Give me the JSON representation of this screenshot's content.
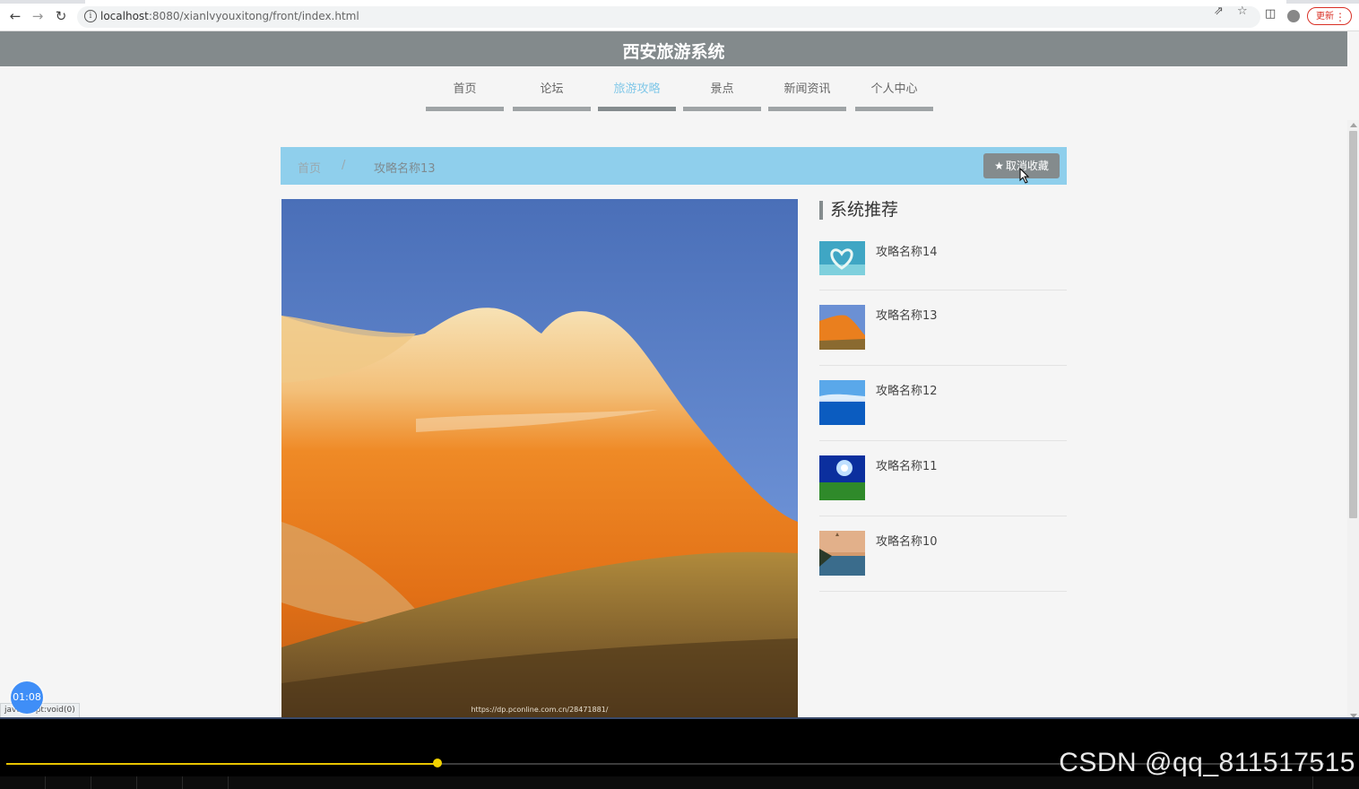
{
  "browser": {
    "url_host": "localhost",
    "url_path": ":8080/xianlvyouxitong/front/index.html",
    "update_label": "更新"
  },
  "site": {
    "title": "西安旅游系统"
  },
  "nav": [
    {
      "label": "首页"
    },
    {
      "label": "论坛"
    },
    {
      "label": "旅游攻略",
      "active": true
    },
    {
      "label": "景点"
    },
    {
      "label": "新闻资讯"
    },
    {
      "label": "个人中心"
    }
  ],
  "breadcrumb": {
    "home": "首页",
    "separator": "/",
    "current": "攻略名称13"
  },
  "favorite_button": {
    "label": "取消收藏",
    "icon": "star-icon"
  },
  "main_image": {
    "caption": "https://dp.pconline.com.cn/28471881/"
  },
  "sidebar": {
    "title": "系统推荐",
    "items": [
      {
        "name": "攻略名称14",
        "thumb": "heart-island"
      },
      {
        "name": "攻略名称13",
        "thumb": "orange-mountain"
      },
      {
        "name": "攻略名称12",
        "thumb": "blue-sea"
      },
      {
        "name": "攻略名称11",
        "thumb": "sun-field"
      },
      {
        "name": "攻略名称10",
        "thumb": "lake-tree"
      }
    ]
  },
  "status_bar": {
    "text": "javascript:void(0)"
  },
  "overlay": {
    "timer": "01:08"
  },
  "player": {
    "progress": 0.327
  },
  "watermark": {
    "text": "CSDN @qq_811517515"
  },
  "colors": {
    "header_bg": "#838a8c",
    "breadcrumb_bg": "#8fcfec",
    "nav_active": "#82c8e8",
    "progress": "#e8c400"
  }
}
